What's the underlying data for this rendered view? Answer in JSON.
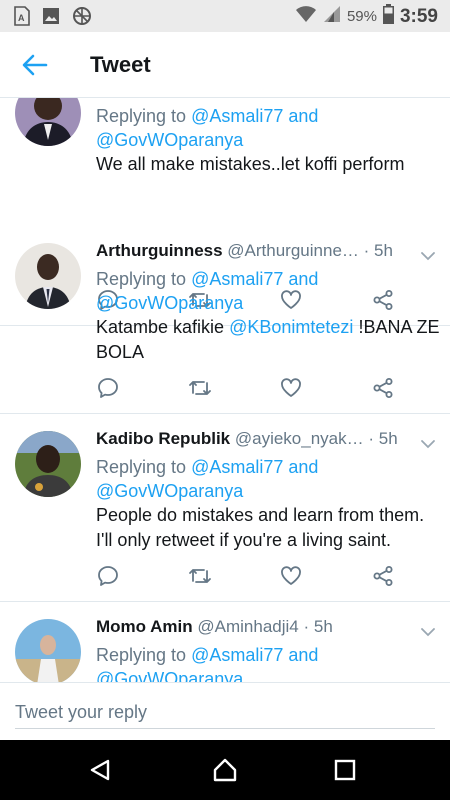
{
  "status_bar": {
    "battery_percent": "59%",
    "time": "3:59",
    "left_icons": [
      "sim-icon",
      "gallery-icon",
      "data-saver-icon"
    ],
    "right_icons": [
      "wifi-icon",
      "signal-icon",
      "battery-icon"
    ]
  },
  "app_bar": {
    "title": "Tweet"
  },
  "tweets": [
    {
      "name": "",
      "handle": "",
      "time": "",
      "replying_prefix": "Replying to",
      "reply_to_1": "@Asmali77",
      "and_word": "and",
      "reply_to_2": "@GovWOparanya",
      "text": "We all make mistakes..let koffi perform"
    },
    {
      "name": "Arthurguinness",
      "handle": "@Arthurguinne…",
      "time": "· 5h",
      "replying_prefix": "Replying to",
      "reply_to_1": "@Asmali77",
      "and_word": "and",
      "reply_to_2": "@GovWOparanya",
      "text_1": "Katambe kafikie",
      "text_mention": "@KBonimtetezi",
      "text_2": "!BANA ZE BOLA"
    },
    {
      "name": "Kadibo Republik",
      "handle": "@ayieko_nyak…",
      "time": "· 5h",
      "replying_prefix": "Replying to",
      "reply_to_1": "@Asmali77",
      "and_word": "and",
      "reply_to_2": "@GovWOparanya",
      "text": "People do mistakes and learn from them. I'll only retweet if you're a living saint."
    },
    {
      "name": "Momo Amin",
      "handle": "@Aminhadji4",
      "time": "· 5h",
      "replying_prefix": "Replying to",
      "reply_to_1": "@Asmali77",
      "and_word": "and",
      "reply_to_2": "@GovWOparanya"
    }
  ],
  "composer": {
    "placeholder": "Tweet your reply"
  },
  "colors": {
    "accent": "#1da1f2",
    "secondary_text": "#657786",
    "action_icon": "#657786"
  }
}
